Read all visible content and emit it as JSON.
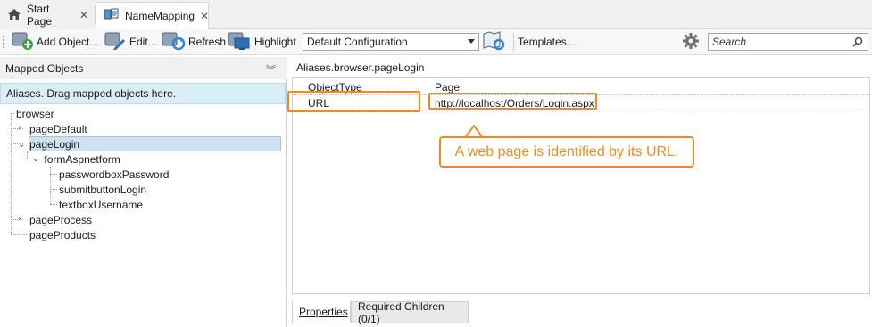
{
  "tabs": [
    {
      "label": "Start Page",
      "icon": "home-icon"
    },
    {
      "label": "NameMapping",
      "icon": "namemapping-icon"
    }
  ],
  "toolbar": {
    "add_label_prefix": "Add Object",
    "add_label_suffix": "...",
    "edit_label": "Edit...",
    "refresh_label": "Refresh",
    "highlight_label": "Highlight",
    "configuration_value": "Default Configuration",
    "templates_label": "Templates...",
    "search_placeholder": "Search"
  },
  "left_pane": {
    "title": "Mapped Objects",
    "drop_hint": "Aliases. Drag mapped objects here.",
    "tree": {
      "root": "browser",
      "page_default": "pageDefault",
      "page_login": "pageLogin",
      "form": "formAspnetform",
      "password": "passwordboxPassword",
      "submit": "submitbuttonLogin",
      "username": "textboxUsername",
      "page_process": "pageProcess",
      "page_products": "pageProducts"
    }
  },
  "right_pane": {
    "path": "Aliases.browser.pageLogin",
    "properties": [
      {
        "key": "ObjectType",
        "value": "Page"
      },
      {
        "key": "URL",
        "value": "http://localhost/Orders/Login.aspx"
      }
    ],
    "callout": "A web page is identified by its URL.",
    "bottom_tabs": [
      "Properties",
      "Required Children (0/1)"
    ]
  },
  "colors": {
    "accent_orange": "#f08a1c",
    "hint_bg": "#d9eef5",
    "selection_bg": "#cfe3ef"
  }
}
